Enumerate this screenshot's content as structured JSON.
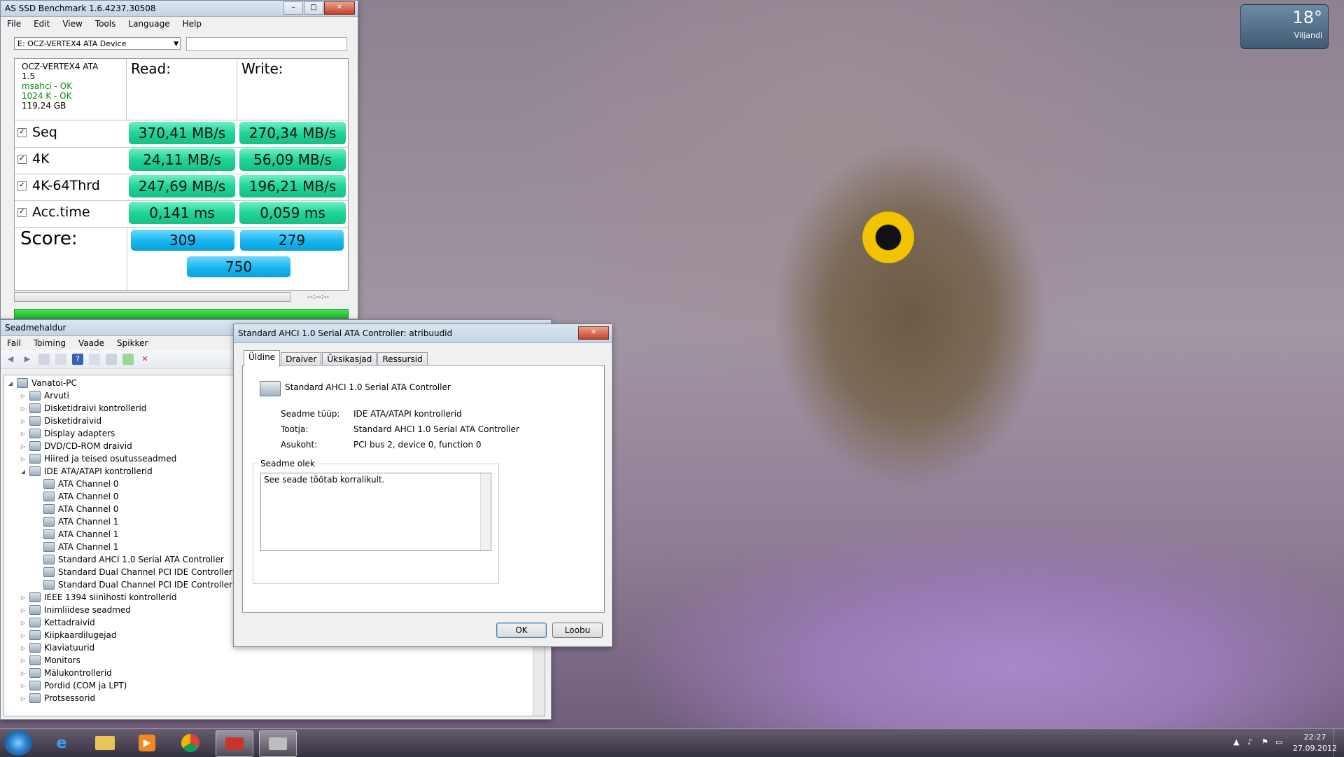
{
  "gadget": {
    "temperature": "18°",
    "city": "Viljandi"
  },
  "asssd": {
    "title": "AS SSD Benchmark 1.6.4237.30508",
    "menu": [
      "File",
      "Edit",
      "View",
      "Tools",
      "Language",
      "Help"
    ],
    "device_select": "E: OCZ-VERTEX4 ATA Device",
    "info": {
      "model": "OCZ-VERTEX4 ATA",
      "firmware": "1.5",
      "driver": "msahci - OK",
      "alignment": "1024 K - OK",
      "size": "119,24 GB"
    },
    "read_header": "Read:",
    "write_header": "Write:",
    "rows": [
      {
        "label": "Seq",
        "checked": true,
        "read": "370,41 MB/s",
        "write": "270,34 MB/s"
      },
      {
        "label": "4K",
        "checked": true,
        "read": "24,11 MB/s",
        "write": "56,09 MB/s"
      },
      {
        "label": "4K-64Thrd",
        "checked": true,
        "read": "247,69 MB/s",
        "write": "196,21 MB/s"
      },
      {
        "label": "Acc.time",
        "checked": true,
        "read": "0,141 ms",
        "write": "0,059 ms"
      }
    ],
    "score_label": "Score:",
    "score_read": "309",
    "score_write": "279",
    "score_total": "750",
    "time_display": "--:--:--",
    "check_mark": "✓"
  },
  "devmgr": {
    "title": "Seadmehaldur",
    "menu": [
      "Fail",
      "Toiming",
      "Vaade",
      "Spikker"
    ],
    "tree": {
      "root": "Vanatoi-PC",
      "items": [
        {
          "label": "Arvuti",
          "level": 1,
          "toggle": "▷"
        },
        {
          "label": "Disketidraivi kontrollerid",
          "level": 1,
          "toggle": "▷"
        },
        {
          "label": "Disketidraivid",
          "level": 1,
          "toggle": "▷"
        },
        {
          "label": "Display adapters",
          "level": 1,
          "toggle": "▷"
        },
        {
          "label": "DVD/CD-ROM draivid",
          "level": 1,
          "toggle": "▷"
        },
        {
          "label": "Hiired ja teised osutusseadmed",
          "level": 1,
          "toggle": "▷"
        },
        {
          "label": "IDE ATA/ATAPI kontrollerid",
          "level": 1,
          "toggle": "◢"
        },
        {
          "label": "ATA Channel 0",
          "level": 2,
          "toggle": ""
        },
        {
          "label": "ATA Channel 0",
          "level": 2,
          "toggle": ""
        },
        {
          "label": "ATA Channel 0",
          "level": 2,
          "toggle": ""
        },
        {
          "label": "ATA Channel 1",
          "level": 2,
          "toggle": ""
        },
        {
          "label": "ATA Channel 1",
          "level": 2,
          "toggle": ""
        },
        {
          "label": "ATA Channel 1",
          "level": 2,
          "toggle": ""
        },
        {
          "label": "Standard AHCI 1.0 Serial ATA Controller",
          "level": 2,
          "toggle": ""
        },
        {
          "label": "Standard Dual Channel PCI IDE Controller",
          "level": 2,
          "toggle": ""
        },
        {
          "label": "Standard Dual Channel PCI IDE Controller",
          "level": 2,
          "toggle": ""
        },
        {
          "label": "IEEE 1394 siinihosti kontrollerid",
          "level": 1,
          "toggle": "▷"
        },
        {
          "label": "Inimliidese seadmed",
          "level": 1,
          "toggle": "▷"
        },
        {
          "label": "Kettadraivid",
          "level": 1,
          "toggle": "▷"
        },
        {
          "label": "Kiipkaardilugejad",
          "level": 1,
          "toggle": "▷"
        },
        {
          "label": "Klaviatuurid",
          "level": 1,
          "toggle": "▷"
        },
        {
          "label": "Monitors",
          "level": 1,
          "toggle": "▷"
        },
        {
          "label": "Mälukontrollerid",
          "level": 1,
          "toggle": "▷"
        },
        {
          "label": "Pordid (COM ja LPT)",
          "level": 1,
          "toggle": "▷"
        },
        {
          "label": "Protsessorid",
          "level": 1,
          "toggle": "▷"
        }
      ]
    }
  },
  "props": {
    "title": "Standard AHCI 1.0 Serial ATA Controller: atribuudid",
    "tabs": [
      "Üldine",
      "Draiver",
      "Üksikasjad",
      "Ressursid"
    ],
    "device_name": "Standard AHCI 1.0 Serial ATA Controller",
    "fields": [
      {
        "key": "Seadme tüüp:",
        "value": "IDE ATA/ATAPI kontrollerid"
      },
      {
        "key": "Tootja:",
        "value": "Standard AHCI 1.0 Serial ATA Controller"
      },
      {
        "key": "Asukoht:",
        "value": "PCI bus 2, device 0, function 0"
      }
    ],
    "status_group": "Seadme olek",
    "status_text": "See seade töötab korralikult.",
    "ok": "OK",
    "cancel": "Loobu"
  },
  "taskbar": {
    "time": "22:27",
    "date": "27.09.2012"
  }
}
